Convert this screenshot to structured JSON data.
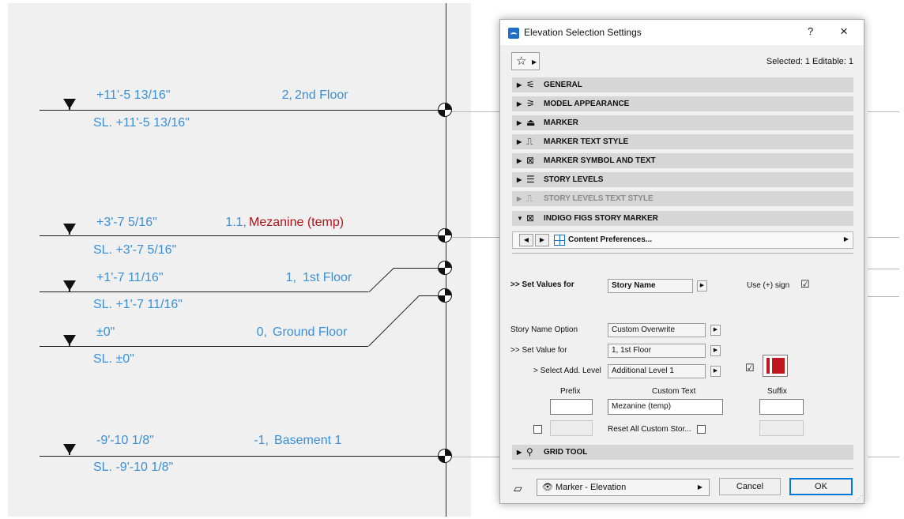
{
  "drawing": {
    "levels": [
      {
        "elevation": "+11'-5 13/16\"",
        "story_num": "2,",
        "story_name": "2nd Floor",
        "sl": "SL. +11'-5 13/16\""
      },
      {
        "elevation": "+3'-7 5/16\"",
        "story_num": "1.1,",
        "story_name": "Mezanine (temp)",
        "sl": "SL. +3'-7 5/16\""
      },
      {
        "elevation": "+1'-7 11/16\"",
        "story_num": "1,",
        "story_name": "1st Floor",
        "sl": "SL. +1'-7 11/16\""
      },
      {
        "elevation": "±0\"",
        "story_num": "0,",
        "story_name": "Ground Floor",
        "sl": "SL. ±0\""
      },
      {
        "elevation": "-9'-10 1/8\"",
        "story_num": "-1,",
        "story_name": "Basement 1",
        "sl": "SL. -9'-10 1/8\""
      }
    ],
    "label_color": "#3b8fd6",
    "highlight_color": "#b0131a"
  },
  "dialog": {
    "title": "Elevation Selection Settings",
    "help_label": "?",
    "close_label": "×",
    "favorites_icon": "☆",
    "selected_info": "Selected: 1 Editable: 1",
    "panels": [
      {
        "label": "GENERAL",
        "icon": "general-icon"
      },
      {
        "label": "MODEL APPEARANCE",
        "icon": "model-appearance-icon"
      },
      {
        "label": "MARKER",
        "icon": "marker-icon"
      },
      {
        "label": "MARKER TEXT STYLE",
        "icon": "text-style-icon"
      },
      {
        "label": "MARKER SYMBOL AND TEXT",
        "icon": "symbol-text-icon"
      },
      {
        "label": "STORY LEVELS",
        "icon": "story-levels-icon"
      },
      {
        "label": "STORY LEVELS TEXT STYLE",
        "icon": "text-style-icon"
      },
      {
        "label": "INDIGO FIGS STORY MARKER",
        "icon": "symbol-text-icon"
      }
    ],
    "content_pref_label": "Content Preferences...",
    "set_values_for_label": ">> Set Values for",
    "set_values_for_value": "Story Name",
    "use_sign_label": "Use (+) sign",
    "use_sign_checked": "☑",
    "story_name_option_label": "Story Name Option",
    "story_name_option_value": "Custom Overwrite",
    "set_value_for_label": ">> Set Value for",
    "set_value_for_value": "1, 1st Floor",
    "select_add_level_label": "> Select Add. Level",
    "select_add_level_value": "Additional Level 1",
    "add_level_checked": "☑",
    "prefix_label": "Prefix",
    "custom_text_label": "Custom Text",
    "suffix_label": "Suffix",
    "prefix_value": "",
    "custom_text_value": "Mezanine (temp)",
    "suffix_value": "",
    "reset_label": "Reset All Custom Stor...",
    "grid_tool_label": "GRID TOOL",
    "footer_view_label": "Marker - Elevation",
    "cancel_label": "Cancel",
    "ok_label": "OK",
    "accent_color": "#0078d7",
    "swatch_color": "#c0171f"
  }
}
